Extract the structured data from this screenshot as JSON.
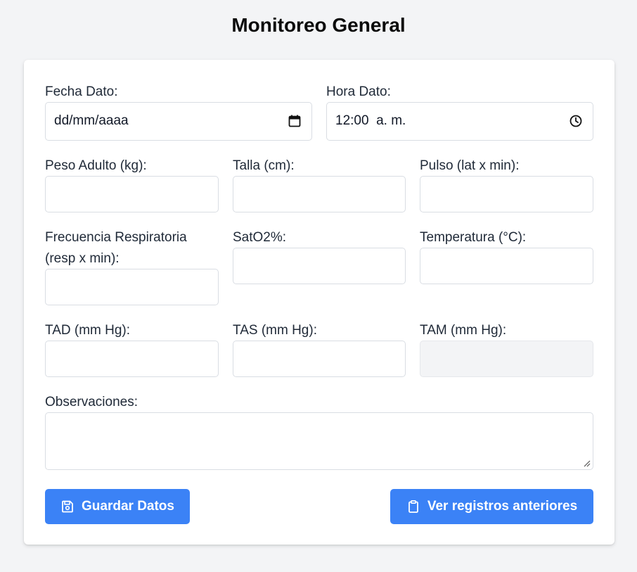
{
  "page": {
    "title": "Monitoreo General"
  },
  "form": {
    "fecha": {
      "label": "Fecha Dato:",
      "value": "dd/mm/aaaa",
      "icon": "calendar-icon"
    },
    "hora": {
      "label": "Hora Dato:",
      "value": "12:00  a. m.",
      "icon": "clock-icon"
    },
    "peso": {
      "label": "Peso Adulto (kg):",
      "value": ""
    },
    "talla": {
      "label": "Talla (cm):",
      "value": ""
    },
    "pulso": {
      "label": "Pulso (lat x min):",
      "value": ""
    },
    "frecuencia": {
      "label_line1": "Frecuencia Respiratoria",
      "label_line2": "(resp x min):",
      "value": ""
    },
    "sato2": {
      "label": "SatO2%:",
      "value": ""
    },
    "temperatura": {
      "label": "Temperatura (°C):",
      "value": ""
    },
    "tad": {
      "label": "TAD (mm Hg):",
      "value": ""
    },
    "tas": {
      "label": "TAS (mm Hg):",
      "value": ""
    },
    "tam": {
      "label": "TAM (mm Hg):",
      "value": "",
      "readonly": true
    },
    "observaciones": {
      "label": "Observaciones:",
      "value": ""
    }
  },
  "actions": {
    "save": {
      "label": "Guardar Datos",
      "icon": "save-icon"
    },
    "history": {
      "label": "Ver registros anteriores",
      "icon": "clipboard-icon"
    }
  },
  "colors": {
    "primary": "#3b82f6",
    "background": "#f3f4f6",
    "card": "#ffffff",
    "border": "#d9dde3",
    "readonly_field": "#f3f4f6"
  }
}
